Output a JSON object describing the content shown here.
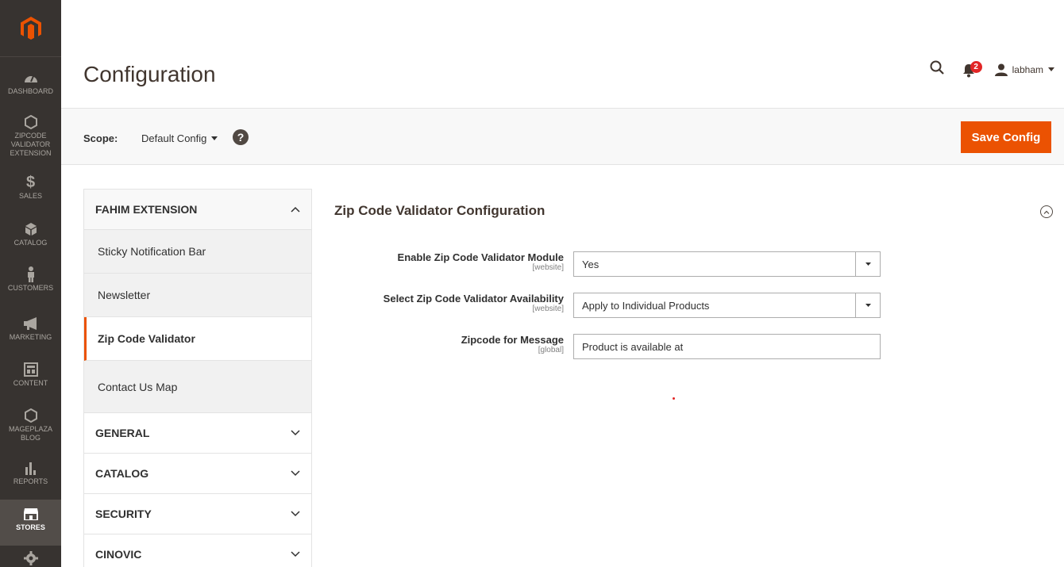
{
  "nav": {
    "items": [
      {
        "label": "DASHBOARD"
      },
      {
        "label": "ZIPCODE VALIDATOR EXTENSION"
      },
      {
        "label": "SALES"
      },
      {
        "label": "CATALOG"
      },
      {
        "label": "CUSTOMERS"
      },
      {
        "label": "MARKETING"
      },
      {
        "label": "CONTENT"
      },
      {
        "label": "MAGEPLAZA BLOG"
      },
      {
        "label": "REPORTS"
      },
      {
        "label": "STORES"
      }
    ]
  },
  "header": {
    "title": "Configuration",
    "notification_count": "2",
    "username": "labham"
  },
  "scope": {
    "label": "Scope:",
    "value": "Default Config",
    "help": "?",
    "save_label": "Save Config"
  },
  "tabs": {
    "groups": [
      {
        "title": "FAHIM EXTENSION"
      },
      {
        "title": "GENERAL"
      },
      {
        "title": "CATALOG"
      },
      {
        "title": "SECURITY"
      },
      {
        "title": "CINOVIC"
      }
    ],
    "items": [
      {
        "label": "Sticky Notification Bar"
      },
      {
        "label": "Newsletter"
      },
      {
        "label": "Zip Code Validator"
      },
      {
        "label": "Contact Us Map"
      }
    ]
  },
  "section": {
    "title": "Zip Code Validator Configuration",
    "fields": [
      {
        "label": "Enable Zip Code Validator Module",
        "scope": "[website]",
        "value": "Yes"
      },
      {
        "label": "Select Zip Code Validator Availability",
        "scope": "[website]",
        "value": "Apply to Individual Products"
      },
      {
        "label": "Zipcode for Message",
        "scope": "[global]",
        "value": "Product is available at"
      }
    ]
  },
  "colors": {
    "accent": "#eb5202",
    "sidebar": "#373330",
    "badge": "#e22626"
  }
}
